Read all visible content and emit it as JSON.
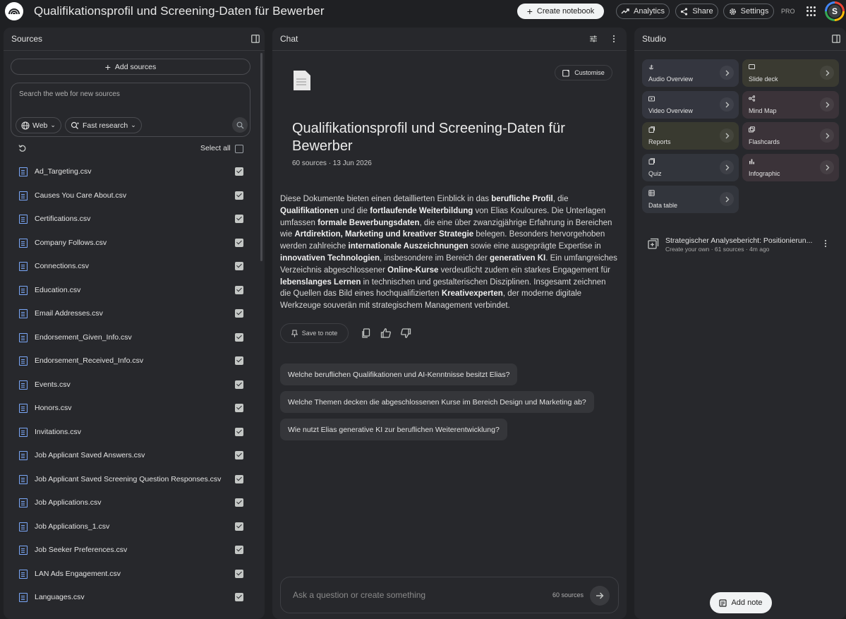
{
  "app": {
    "title": "Qualifikationsprofil und Screening-Daten für Bewerber",
    "create_notebook": "Create notebook",
    "analytics": "Analytics",
    "share": "Share",
    "settings": "Settings",
    "plan_badge": "PRO",
    "avatar_letter": "S"
  },
  "sources": {
    "title": "Sources",
    "add_sources": "Add sources",
    "search_placeholder": "Search the web for new sources",
    "web_chip": "Web",
    "research_chip": "Fast research",
    "select_all": "Select all",
    "items": [
      {
        "name": "Ad_Targeting.csv",
        "checked": true
      },
      {
        "name": "Causes You Care About.csv",
        "checked": true
      },
      {
        "name": "Certifications.csv",
        "checked": true
      },
      {
        "name": "Company Follows.csv",
        "checked": true
      },
      {
        "name": "Connections.csv",
        "checked": true
      },
      {
        "name": "Education.csv",
        "checked": true
      },
      {
        "name": "Email Addresses.csv",
        "checked": true
      },
      {
        "name": "Endorsement_Given_Info.csv",
        "checked": true
      },
      {
        "name": "Endorsement_Received_Info.csv",
        "checked": true
      },
      {
        "name": "Events.csv",
        "checked": true
      },
      {
        "name": "Honors.csv",
        "checked": true
      },
      {
        "name": "Invitations.csv",
        "checked": true
      },
      {
        "name": "Job Applicant Saved Answers.csv",
        "checked": true
      },
      {
        "name": "Job Applicant Saved Screening Question Responses.csv",
        "checked": true
      },
      {
        "name": "Job Applications.csv",
        "checked": true
      },
      {
        "name": "Job Applications_1.csv",
        "checked": true
      },
      {
        "name": "Job Seeker Preferences.csv",
        "checked": true
      },
      {
        "name": "LAN Ads Engagement.csv",
        "checked": true
      },
      {
        "name": "Languages.csv",
        "checked": true
      }
    ]
  },
  "chat": {
    "title": "Chat",
    "customise": "Customise",
    "notebook_title": "Qualifikationsprofil und Screening-Daten für Bewerber",
    "notebook_meta": "60 sources · 13 Jun 2026",
    "summary": [
      {
        "t": "Diese Dokumente bieten einen detaillierten Einblick in das ",
        "b": false
      },
      {
        "t": "berufliche Profil",
        "b": true
      },
      {
        "t": ", die ",
        "b": false
      },
      {
        "t": "Qualifikationen",
        "b": true
      },
      {
        "t": " und die ",
        "b": false
      },
      {
        "t": "fortlaufende Weiterbildung",
        "b": true
      },
      {
        "t": " von Elias Kouloures. Die Unterlagen umfassen ",
        "b": false
      },
      {
        "t": "formale Bewerbungsdaten",
        "b": true
      },
      {
        "t": ", die eine über zwanzigjährige Erfahrung in Bereichen wie ",
        "b": false
      },
      {
        "t": "Artdirektion, Marketing und kreativer Strategie",
        "b": true
      },
      {
        "t": " belegen. Besonders hervorgehoben werden zahlreiche ",
        "b": false
      },
      {
        "t": "internationale Auszeichnungen",
        "b": true
      },
      {
        "t": " sowie eine ausgeprägte Expertise in ",
        "b": false
      },
      {
        "t": "innovativen Technologien",
        "b": true
      },
      {
        "t": ", insbesondere im Bereich der ",
        "b": false
      },
      {
        "t": "generativen KI",
        "b": true
      },
      {
        "t": ". Ein umfangreiches Verzeichnis abgeschlossener ",
        "b": false
      },
      {
        "t": "Online-Kurse",
        "b": true
      },
      {
        "t": " verdeutlicht zudem ein starkes Engagement für ",
        "b": false
      },
      {
        "t": "lebenslanges Lernen",
        "b": true
      },
      {
        "t": " in technischen und gestalterischen Disziplinen. Insgesamt zeichnen die Quellen das Bild eines hochqualifizierten ",
        "b": false
      },
      {
        "t": "Kreativexperten",
        "b": true
      },
      {
        "t": ", der moderne digitale Werkzeuge souverän mit strategischem Management verbindet.",
        "b": false
      }
    ],
    "save_to_note": "Save to note",
    "suggestions": [
      "Welche beruflichen Qualifikationen und AI-Kenntnisse besitzt Elias?",
      "Welche Themen decken die abgeschlossenen Kurse im Bereich Design und Marketing ab?",
      "Wie nutzt Elias generative KI zur beruflichen Weiterentwicklung?"
    ],
    "ask_placeholder": "Ask a question or create something",
    "ask_count": "60 sources"
  },
  "studio": {
    "title": "Studio",
    "tiles": [
      {
        "label": "Audio Overview",
        "icon": "audio-icon",
        "bg": "#34363f"
      },
      {
        "label": "Slide deck",
        "icon": "slides-icon",
        "bg": "#3a3a31"
      },
      {
        "label": "Video Overview",
        "icon": "video-icon",
        "bg": "#34363f"
      },
      {
        "label": "Mind Map",
        "icon": "mindmap-icon",
        "bg": "#3b3339"
      },
      {
        "label": "Reports",
        "icon": "reports-icon",
        "bg": "#393a30"
      },
      {
        "label": "Flashcards",
        "icon": "flashcards-icon",
        "bg": "#3b3339"
      },
      {
        "label": "Quiz",
        "icon": "quiz-icon",
        "bg": "#32353c"
      },
      {
        "label": "Infographic",
        "icon": "infographic-icon",
        "bg": "#3b3339"
      },
      {
        "label": "Data table",
        "icon": "table-icon",
        "bg": "#32353c"
      }
    ],
    "note": {
      "title": "Strategischer Analysebericht: Positionierun...",
      "subtitle": "Create your own · 61 sources · 4m ago"
    },
    "add_note": "Add note"
  }
}
